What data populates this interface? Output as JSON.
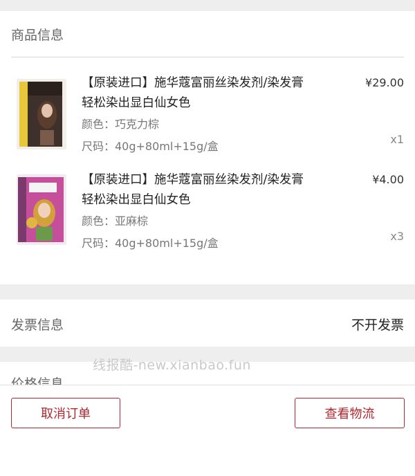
{
  "product_section": {
    "title": "商品信息"
  },
  "products": [
    {
      "name": "【原装进口】施华蔻富丽丝染发剂/染发膏 轻松染出显白仙女色",
      "color": "颜色：巧克力棕",
      "size": "尺码：40g+80ml+15g/盒",
      "price": "¥29.00",
      "qty": "x1",
      "thumb_color": "#6b4a3a"
    },
    {
      "name": "【原装进口】施华蔻富丽丝染发剂/染发膏 轻松染出显白仙女色",
      "color": "颜色：亚麻棕",
      "size": "尺码：40g+80ml+15g/盒",
      "price": "¥4.00",
      "qty": "x3",
      "thumb_color": "#c64f9b"
    }
  ],
  "invoice": {
    "label": "发票信息",
    "value": "不开发票"
  },
  "price_section": {
    "title": "价格信息"
  },
  "watermark": "线报酷-new.xianbao.fun",
  "actions": {
    "cancel_label": "取消订单",
    "logistics_label": "查看物流"
  },
  "colors": {
    "accent": "#b3262d",
    "gap": "#eeeeee"
  }
}
